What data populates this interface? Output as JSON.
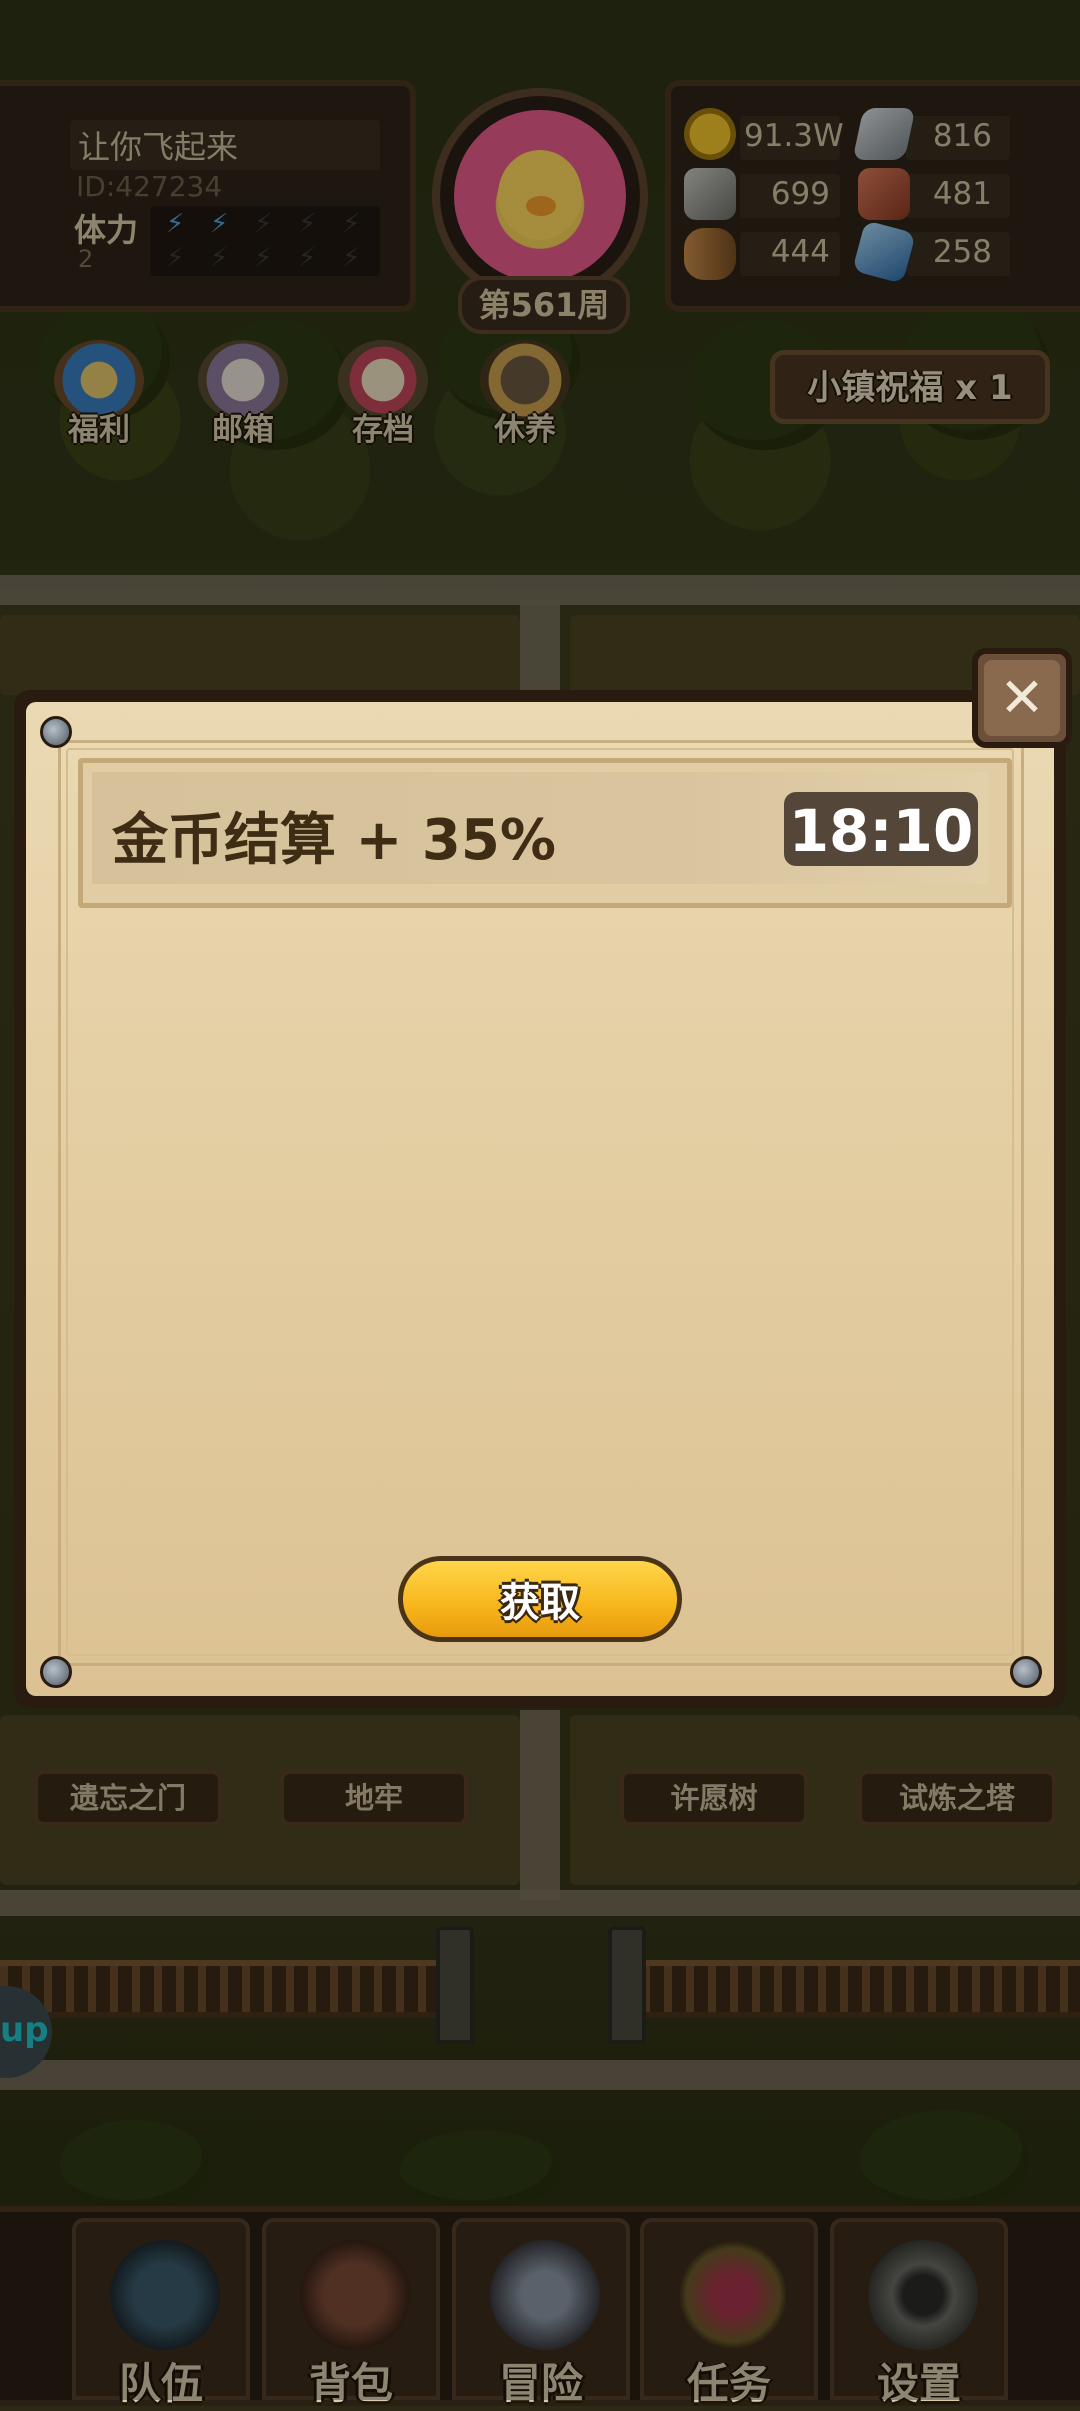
{
  "player": {
    "name": "让你飞起来",
    "id": "ID:427234",
    "stamina_label": "体力",
    "stamina_value": "2",
    "stamina_bolts_filled": 2,
    "stamina_bolts_total": 10,
    "week": "第561周"
  },
  "resources": [
    {
      "icon": "gold-coin-icon",
      "value": "91.3W"
    },
    {
      "icon": "iron-ingot-icon",
      "value": "816"
    },
    {
      "icon": "stone-ore-icon",
      "value": "699"
    },
    {
      "icon": "red-cloth-icon",
      "value": "481"
    },
    {
      "icon": "wood-log-icon",
      "value": "444"
    },
    {
      "icon": "blue-crystal-icon",
      "value": "258"
    }
  ],
  "quick_menu": [
    {
      "label": "福利",
      "icon": "wheel-icon"
    },
    {
      "label": "邮箱",
      "icon": "mail-icon"
    },
    {
      "label": "存档",
      "icon": "scroll-icon"
    },
    {
      "label": "休养",
      "icon": "bed-icon"
    }
  ],
  "blessing": "小镇祝福 x 1",
  "buildings": [
    "遗忘之门",
    "地牢",
    "许愿树",
    "试炼之塔"
  ],
  "modal": {
    "bonus_text": "金币结算 + 35%",
    "timer": "18:10",
    "button_label": "获取",
    "close_icon": "close-x-icon"
  },
  "side_button": "up",
  "bottom_nav": [
    {
      "label": "队伍",
      "icon": "helmet-icon"
    },
    {
      "label": "背包",
      "icon": "backpack-icon"
    },
    {
      "label": "冒险",
      "icon": "crossed-swords-icon"
    },
    {
      "label": "任务",
      "icon": "quest-icon"
    },
    {
      "label": "设置",
      "icon": "gear-icon"
    }
  ],
  "colors": {
    "modal_paper": "#e4cfa4",
    "button_gold": "#f7b51c",
    "timer_bg": "#54473a",
    "stamina_blue": "#4fa4e0"
  }
}
